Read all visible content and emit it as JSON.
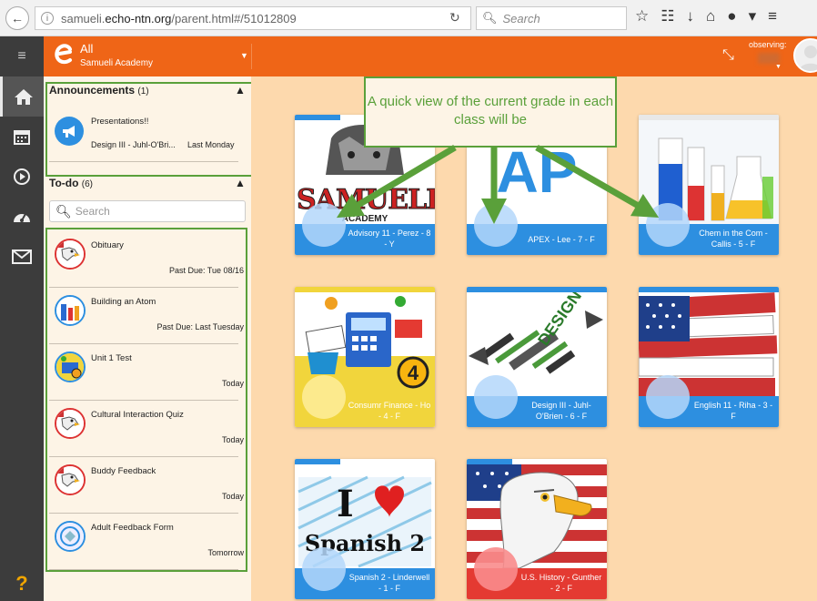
{
  "browser": {
    "url_prefix": "samueli.",
    "url_domain": "echo-ntn.org",
    "url_path": "/parent.html#/51012809",
    "search_placeholder": "Search"
  },
  "header": {
    "scope_title": "All",
    "scope_subtitle": "Samueli Academy",
    "observing_label": "observing:"
  },
  "announcements": {
    "title": "Announcements",
    "count": "(1)",
    "items": [
      {
        "title": "Presentations!!",
        "course": "Design III - Juhl-O'Bri...",
        "date": "Last Monday"
      }
    ]
  },
  "todo": {
    "title": "To-do",
    "count": "(6)",
    "search_placeholder": "Search",
    "items": [
      {
        "title": "Obituary",
        "due": "Past Due: Tue 08/16"
      },
      {
        "title": "Building an Atom",
        "due": "Past Due: Last Tuesday"
      },
      {
        "title": "Unit 1 Test",
        "due": "Today"
      },
      {
        "title": "Cultural Interaction Quiz",
        "due": "Today"
      },
      {
        "title": "Buddy Feedback",
        "due": "Today"
      },
      {
        "title": "Adult Feedback Form",
        "due": "Tomorrow"
      }
    ]
  },
  "callout": {
    "text": "A quick view of the current grade in each class will be"
  },
  "courses": [
    {
      "name": "Advisory 11 - Perez - 8 - Y",
      "color": "#2d8fe0"
    },
    {
      "name": "APEX - Lee - 7 - F",
      "color": "#2d8fe0"
    },
    {
      "name": "Chem in the Com - Callis - 5 - F",
      "color": "#2d8fe0"
    },
    {
      "name": "Consumr Finance - Ho - 4 - F",
      "color": "#f1d53c"
    },
    {
      "name": "Design III - Juhl-O'Brien - 6 - F",
      "color": "#2d8fe0"
    },
    {
      "name": "English 11 - Riha - 3 - F",
      "color": "#2d8fe0"
    },
    {
      "name": "Spanish 2 - Linderwell - 1 - F",
      "color": "#2d8fe0"
    },
    {
      "name": "U.S. History - Gunther - 2 - F",
      "color": "#e43a32"
    }
  ],
  "card_art": {
    "advisory_text": "SAMUELI",
    "advisory_sub": "ACADEMY",
    "apex_text": "AP",
    "finance_number": "4",
    "design_text": "DESIGN",
    "spanish_line1": "I",
    "spanish_line2": "Spanish 2"
  },
  "help_label": "?"
}
